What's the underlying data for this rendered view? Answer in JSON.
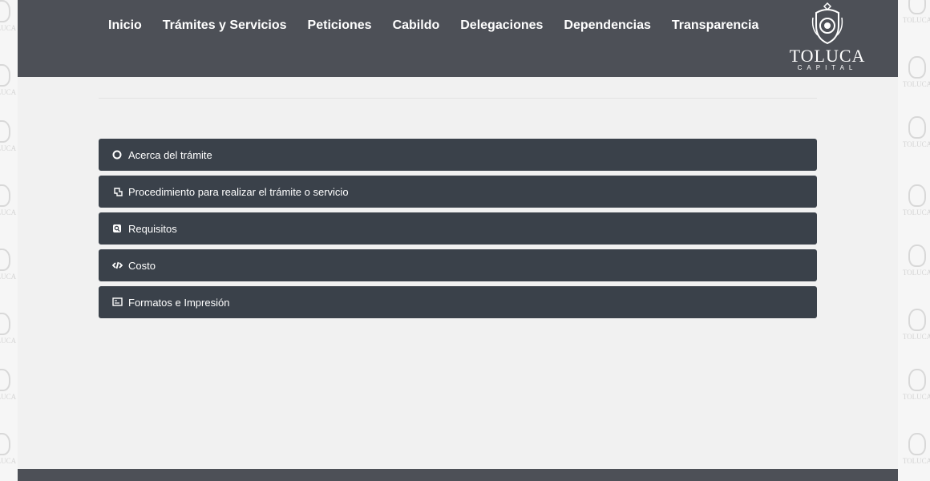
{
  "nav": {
    "items": [
      {
        "label": "Inicio"
      },
      {
        "label": "Trámites y Servicios"
      },
      {
        "label": "Peticiones"
      },
      {
        "label": "Cabildo"
      },
      {
        "label": "Delegaciones"
      },
      {
        "label": "Dependencias"
      },
      {
        "label": "Transparencia"
      }
    ]
  },
  "logo": {
    "title": "TOLUCA",
    "subtitle": "CAPITAL"
  },
  "accordion": {
    "items": [
      {
        "label": "Acerca del trámite",
        "icon": "circle-icon"
      },
      {
        "label": "Procedimiento para realizar el trámite o servicio",
        "icon": "hand-pointer-icon"
      },
      {
        "label": "Requisitos",
        "icon": "search-document-icon"
      },
      {
        "label": "Costo",
        "icon": "code-icon"
      },
      {
        "label": "Formatos e Impresión",
        "icon": "form-icon"
      }
    ]
  },
  "watermark": {
    "text": "TOLUCA"
  },
  "colors": {
    "header": "#4d5057",
    "accordion": "#3a414a",
    "background": "#f1f1f1"
  }
}
